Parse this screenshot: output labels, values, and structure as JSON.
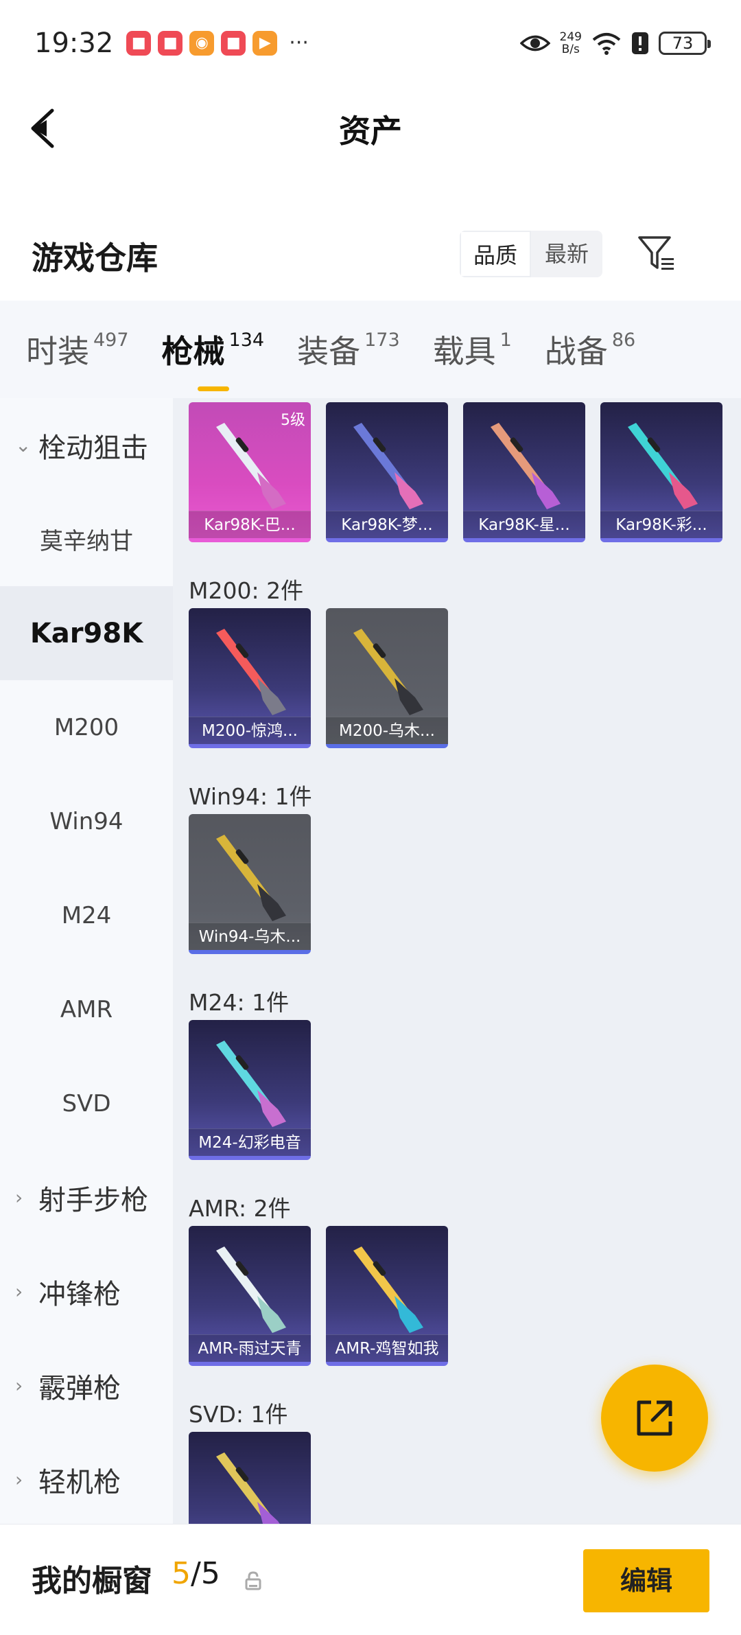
{
  "status_bar": {
    "time": "19:32",
    "net_speed_value": "249",
    "net_speed_unit": "B/s",
    "battery": "73",
    "more": "···",
    "icons": [
      "eye-icon",
      "wifi-icon",
      "alert-icon",
      "battery-icon"
    ]
  },
  "header": {
    "title": "资产"
  },
  "section": {
    "title": "游戏仓库",
    "sort_options": [
      "品质",
      "最新"
    ],
    "sort_selected": "品质"
  },
  "tabs": [
    {
      "label": "时装",
      "count": "497"
    },
    {
      "label": "枪械",
      "count": "134"
    },
    {
      "label": "装备",
      "count": "173"
    },
    {
      "label": "载具",
      "count": "1"
    },
    {
      "label": "战备",
      "count": "86"
    }
  ],
  "active_tab": "枪械",
  "subnav": [
    {
      "label": "栓动狙击",
      "type": "group",
      "expanded": true
    },
    {
      "label": "莫辛纳甘",
      "type": "item"
    },
    {
      "label": "Kar98K",
      "type": "item",
      "active": true
    },
    {
      "label": "M200",
      "type": "item"
    },
    {
      "label": "Win94",
      "type": "item"
    },
    {
      "label": "M24",
      "type": "item"
    },
    {
      "label": "AMR",
      "type": "item"
    },
    {
      "label": "SVD",
      "type": "item"
    },
    {
      "label": "射手步枪",
      "type": "group"
    },
    {
      "label": "冲锋枪",
      "type": "group"
    },
    {
      "label": "霰弹枪",
      "type": "group"
    },
    {
      "label": "轻机枪",
      "type": "group"
    }
  ],
  "groups": [
    {
      "label": "",
      "items": [
        {
          "name": "Kar98K-巴...",
          "level": "5级",
          "style": "gold"
        },
        {
          "name": "Kar98K-梦...",
          "style": "purple"
        },
        {
          "name": "Kar98K-星...",
          "style": "purple"
        },
        {
          "name": "Kar98K-彩...",
          "style": "purple"
        }
      ]
    },
    {
      "label": "M200: 2件",
      "items": [
        {
          "name": "M200-惊鸿...",
          "style": "purple"
        },
        {
          "name": "M200-乌木...",
          "style": "gray"
        }
      ]
    },
    {
      "label": "Win94: 1件",
      "items": [
        {
          "name": "Win94-乌木...",
          "style": "gray"
        }
      ]
    },
    {
      "label": "M24: 1件",
      "items": [
        {
          "name": "M24-幻彩电音",
          "style": "purple"
        }
      ]
    },
    {
      "label": "AMR: 2件",
      "items": [
        {
          "name": "AMR-雨过天青",
          "style": "purple"
        },
        {
          "name": "AMR-鸡智如我",
          "style": "purple"
        }
      ]
    },
    {
      "label": "SVD: 1件",
      "items": [
        {
          "name": "",
          "style": "purple"
        }
      ]
    }
  ],
  "bottom_bar": {
    "title": "我的橱窗",
    "count_current": "5",
    "count_total": "/5",
    "edit_label": "编辑"
  },
  "colors": {
    "accent": "#f7b500",
    "card_purple": "#3c3a78",
    "card_gold": "#d94cc0",
    "card_gray": "#5d6068"
  }
}
